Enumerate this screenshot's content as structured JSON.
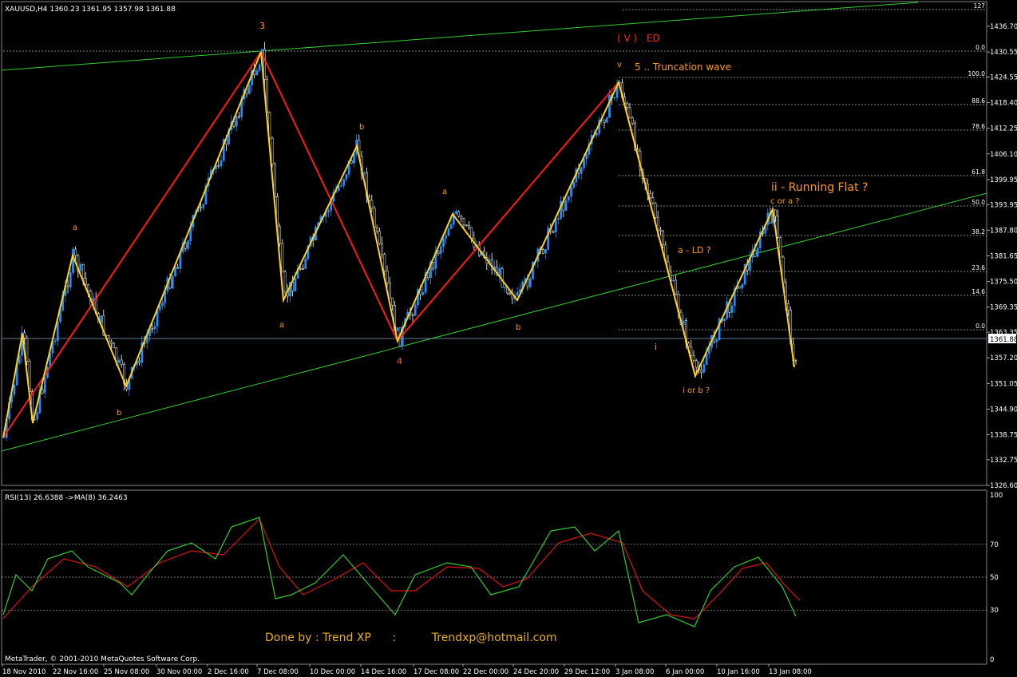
{
  "main": {
    "header": "XAUUSD,H4  1360.23 1361.95 1357.98 1361.88",
    "price_ticks": [
      "1436.70",
      "1430.55",
      "1424.55",
      "1418.40",
      "1412.25",
      "1406.10",
      "1399.95",
      "1393.95",
      "1387.80",
      "1381.65",
      "1375.50",
      "1369.35",
      "1363.35",
      "1357.20",
      "1351.05",
      "1344.90",
      "1338.75",
      "1332.75",
      "1326.60"
    ],
    "current_price": "1361.88",
    "fib_levels": [
      "127",
      "0.0",
      "100.0",
      "88.6",
      "78.6",
      "61.8",
      "50.0",
      "38.2",
      "23.6",
      "14.6",
      "0.0"
    ],
    "annotations": [
      "3",
      "( V )",
      "ED",
      "v",
      "5 .. Truncation wave",
      "b",
      "a",
      "a",
      "ii - Running Flat ?",
      "c or a ?",
      "a - LD ?",
      "a",
      "b",
      "4",
      "b",
      "i",
      "i or b ?",
      "b"
    ]
  },
  "rsi": {
    "header": "RSI(13) 26.6388   ->MA(8) 36.2463",
    "levels": [
      "100",
      "70",
      "50",
      "30",
      "0"
    ]
  },
  "credit": "Done by : Trend XP      :          Trendxp@hotmail.com",
  "footer": {
    "copyright": "MetaTrader, © 2001-2010 MetaQuotes Software Corp.",
    "dates": [
      "18 Nov 2010",
      "22 Nov 16:00",
      "25 Nov 08:00",
      "30 Nov 00:00",
      "2 Dec 16:00",
      "7 Dec 08:00",
      "10 Dec 00:00",
      "14 Dec 16:00",
      "17 Dec 08:00",
      "22 Dec 00:00",
      "24 Dec 20:00",
      "29 Dec 12:00",
      "3 Jan 08:00",
      "6 Jan 00:00",
      "10 Jan 16:00",
      "13 Jan 08:00"
    ]
  },
  "colors": {
    "bull": "#1e90ff",
    "bear": "#ffffff",
    "waveRed": "#ff1a1a",
    "waveYellow": "#ffd21e",
    "trend": "#33cc33",
    "label": "#ff9a1a",
    "rsi": "#33cc33",
    "rsiMa": "#dd1111"
  },
  "chart_data": {
    "type": "line",
    "title": "XAUUSD,H4",
    "x": [
      "18 Nov 2010",
      "22 Nov 16:00",
      "25 Nov 08:00",
      "30 Nov 00:00",
      "2 Dec 16:00",
      "7 Dec 08:00",
      "10 Dec 00:00",
      "14 Dec 16:00",
      "17 Dec 08:00",
      "22 Dec 00:00",
      "24 Dec 20:00",
      "29 Dec 12:00",
      "3 Jan 08:00",
      "6 Jan 00:00",
      "10 Jan 16:00",
      "13 Jan 08:00"
    ],
    "ylim": [
      1326.6,
      1436.7
    ],
    "series": [
      {
        "name": "red wave",
        "values": [
          1338,
          1430.5,
          1362,
          1424,
          1354
        ]
      },
      {
        "name": "yellow wave",
        "values": [
          1338,
          1363,
          1343,
          1379,
          1351,
          1430.5,
          1370,
          1408,
          1362,
          1388,
          1370,
          1424,
          1352,
          1393,
          1355
        ]
      }
    ],
    "rsi": {
      "name": "RSI(13)",
      "last": 26.6388,
      "ma": 36.2463,
      "ylim": [
        0,
        100
      ]
    }
  }
}
